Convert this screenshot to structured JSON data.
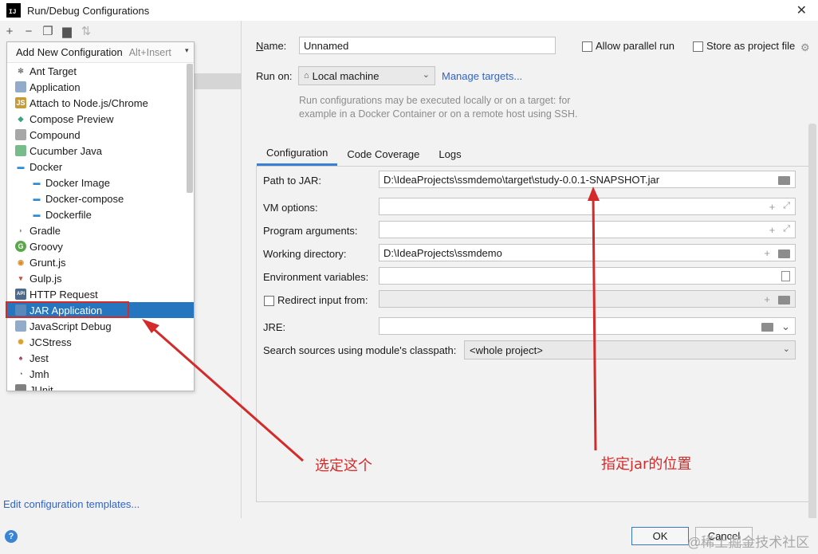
{
  "window": {
    "title": "Run/Debug Configurations",
    "app_icon": "IJ"
  },
  "left": {
    "popup_header": {
      "label": "Add New Configuration",
      "shortcut": "Alt+Insert"
    },
    "items": [
      {
        "label": "Ant Target",
        "icon": "ant-icon",
        "color": "#7a7a7a",
        "glyph": "✻"
      },
      {
        "label": "Application",
        "icon": "application-icon",
        "color": "#6d8fb9",
        "glyph": ""
      },
      {
        "label": "Attach to Node.js/Chrome",
        "icon": "nodejs-icon",
        "color": "#c69b3a",
        "glyph": "JS"
      },
      {
        "label": "Compose Preview",
        "icon": "compose-icon",
        "color": "#3aa57a",
        "glyph": "◆"
      },
      {
        "label": "Compound",
        "icon": "compound-icon",
        "color": "#8a8a8a",
        "glyph": ""
      },
      {
        "label": "Cucumber Java",
        "icon": "cucumber-icon",
        "color": "#4aa564",
        "glyph": ""
      },
      {
        "label": "Docker",
        "icon": "docker-icon",
        "color": "#2f8ad6",
        "glyph": "▬"
      },
      {
        "label": "Docker Image",
        "icon": "docker-icon",
        "color": "#2f8ad6",
        "glyph": "▬",
        "child": true
      },
      {
        "label": "Docker-compose",
        "icon": "docker-icon",
        "color": "#2f8ad6",
        "glyph": "▬",
        "child": true
      },
      {
        "label": "Dockerfile",
        "icon": "docker-icon",
        "color": "#2f8ad6",
        "glyph": "▬",
        "child": true
      },
      {
        "label": "Gradle",
        "icon": "gradle-icon",
        "color": "#8d8d8d",
        "glyph": "◗"
      },
      {
        "label": "Groovy",
        "icon": "groovy-icon",
        "color": "#5aa84a",
        "glyph": "G"
      },
      {
        "label": "Grunt.js",
        "icon": "grunt-icon",
        "color": "#d98d2a",
        "glyph": "◉"
      },
      {
        "label": "Gulp.js",
        "icon": "gulp-icon",
        "color": "#d44a3a",
        "glyph": "▾"
      },
      {
        "label": "HTTP Request",
        "icon": "api-icon",
        "color": "#4c6a8c",
        "glyph": "API"
      },
      {
        "label": "JAR Application",
        "icon": "jar-icon",
        "color": "#6d8fb9",
        "glyph": "",
        "selected": true
      },
      {
        "label": "JavaScript Debug",
        "icon": "js-debug-icon",
        "color": "#6d8fb9",
        "glyph": ""
      },
      {
        "label": "JCStress",
        "icon": "jcstress-icon",
        "color": "#d9a02a",
        "glyph": "✺"
      },
      {
        "label": "Jest",
        "icon": "jest-icon",
        "color": "#9a3a5a",
        "glyph": "♠"
      },
      {
        "label": "Jmh",
        "icon": "jmh-icon",
        "color": "#555555",
        "glyph": "◔"
      },
      {
        "label": "JUnit",
        "icon": "junit-icon",
        "color": "#555555",
        "glyph": ""
      }
    ],
    "edit_templates": "Edit configuration templates..."
  },
  "right": {
    "name_label": "Name:",
    "name_value": "Unnamed",
    "allow_parallel": "Allow parallel run",
    "store_as_file": "Store as project file",
    "run_on_label": "Run on:",
    "run_on_value": "Local machine",
    "manage_targets": "Manage targets...",
    "hint_line1": "Run configurations may be executed locally or on a target: for",
    "hint_line2": "example in a Docker Container or on a remote host using SSH.",
    "tabs": [
      "Configuration",
      "Code Coverage",
      "Logs"
    ],
    "fields": {
      "path_to_jar": {
        "label": "Path to JAR:",
        "value": "D:\\IdeaProjects\\ssmdemo\\target\\study-0.0.1-SNAPSHOT.jar"
      },
      "vm_options": {
        "label": "VM options:",
        "value": ""
      },
      "program_args": {
        "label": "Program arguments:",
        "value": ""
      },
      "working_dir": {
        "label": "Working directory:",
        "value": "D:\\IdeaProjects\\ssmdemo"
      },
      "env_vars": {
        "label": "Environment variables:",
        "value": ""
      },
      "redirect_input": {
        "label": "Redirect input from:",
        "value": ""
      },
      "jre": {
        "label": "JRE:",
        "value": ""
      },
      "search_sources": {
        "label": "Search sources using module's classpath:",
        "value": "<whole project>"
      }
    }
  },
  "buttons": {
    "ok": "OK",
    "cancel": "Cancel"
  },
  "annotations": {
    "select_this": "选定这个",
    "specify_jar": "指定jar的位置"
  },
  "watermark": "@稀土掘金技术社区"
}
